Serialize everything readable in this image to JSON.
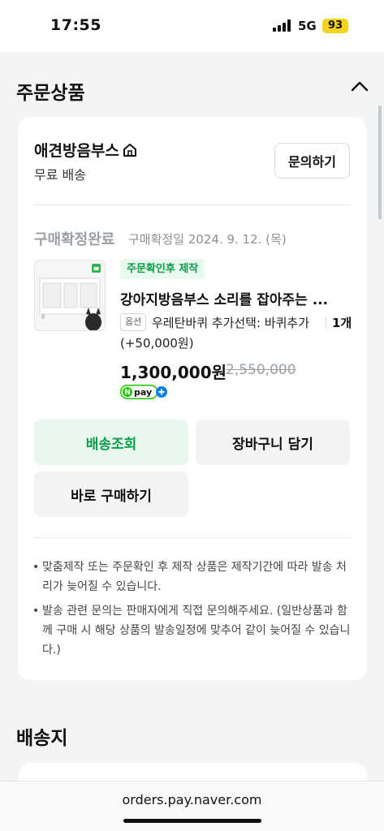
{
  "status_bar": {
    "time": "17:55",
    "network": "5G",
    "battery": "93"
  },
  "order_section": {
    "title": "주문상품"
  },
  "store": {
    "name": "애견방음부스",
    "shipping": "무료 배송",
    "inquiry_button": "문의하기"
  },
  "purchase": {
    "status": "구매확정완료",
    "confirm_date": "구매확정일 2024. 9. 12. (목)"
  },
  "product": {
    "badge": "주문확인후 제작",
    "name": "강아지방음부스 소리를 잡아주는 ...",
    "option_tag": "옵션",
    "option_text": "우레탄바퀴 추가선택: 바퀴추가",
    "quantity": "1개",
    "option_extra": "(+50,000원)",
    "price": "1,300,000원",
    "original_price": "2,550,000",
    "npay_label": "pay"
  },
  "buttons": {
    "track": "배송조회",
    "cart": "장바구니 담기",
    "buy_now": "바로 구매하기"
  },
  "notes": [
    "맞춤제작 또는 주문확인 후 제작 상품은 제작기간에 따라 발송 처리가 늦어질 수 있습니다.",
    "발송 관련 문의는 판매자에게 직접 문의해주세요. (일반상품과 함께 구매 시 해당 상품의 발송일정에 맞추어 같이 늦어질 수 있습니다.)"
  ],
  "delivery_section": {
    "title": "배송지"
  },
  "browser": {
    "url": "orders.pay.naver.com"
  },
  "colors": {
    "accent_green": "#0a9c49",
    "battery_yellow": "#f4d418"
  }
}
